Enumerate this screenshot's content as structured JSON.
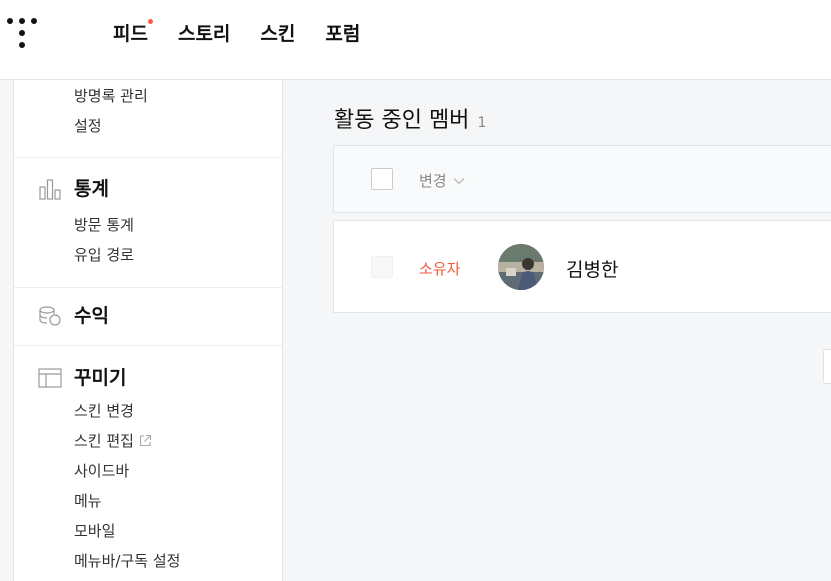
{
  "header": {
    "nav": [
      {
        "label": "피드",
        "has_notification": true
      },
      {
        "label": "스토리"
      },
      {
        "label": "스킨"
      },
      {
        "label": "포럼"
      }
    ]
  },
  "sidebar": {
    "top_links": [
      "방명록 관리",
      "설정"
    ],
    "sections": [
      {
        "title": "통계",
        "icon": "bar-chart-icon",
        "links": [
          "방문 통계",
          "유입 경로"
        ]
      },
      {
        "title": "수익",
        "icon": "coins-icon",
        "links": []
      },
      {
        "title": "꾸미기",
        "icon": "layout-icon",
        "links": [
          "스킨 변경",
          "스킨 편집",
          "사이드바",
          "메뉴",
          "모바일",
          "메뉴바/구독 설정"
        ]
      }
    ]
  },
  "main": {
    "title": "활동 중인 멤버",
    "count": "1",
    "table": {
      "change_label": "변경",
      "rows": [
        {
          "role": "소유자",
          "name": "김병한"
        }
      ]
    }
  },
  "colors": {
    "accent": "#f05a3c",
    "notification_dot": "#ff5544"
  }
}
